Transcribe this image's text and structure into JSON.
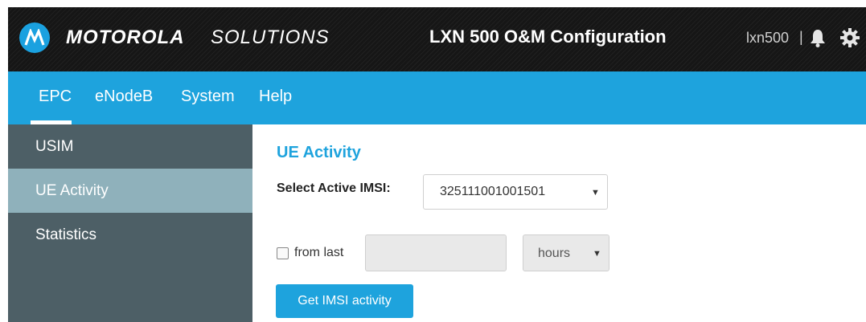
{
  "header": {
    "brand_bold": "MOTOROLA",
    "brand_light": "SOLUTIONS",
    "app_title": "LXN 500 O&M Configuration",
    "user": "lxn500",
    "separator": "|",
    "icons": [
      "motorola-logo-icon",
      "bell-icon",
      "gear-icon"
    ]
  },
  "nav": {
    "items": [
      {
        "label": "EPC",
        "active": true
      },
      {
        "label": "eNodeB",
        "active": false
      },
      {
        "label": "System",
        "active": false
      },
      {
        "label": "Help",
        "active": false
      }
    ]
  },
  "sidebar": {
    "items": [
      {
        "label": "USIM",
        "active": false
      },
      {
        "label": "UE Activity",
        "active": true
      },
      {
        "label": "Statistics",
        "active": false
      }
    ]
  },
  "main": {
    "title": "UE Activity",
    "imsi_label": "Select Active IMSI:",
    "imsi_value": "325111001001501",
    "from_last_label": "from last",
    "from_last_checked": false,
    "duration_value": "",
    "unit_value": "hours",
    "get_button": "Get IMSI activity"
  },
  "colors": {
    "accent": "#1ea3dd",
    "sidebar_bg": "#4d5f66",
    "sidebar_active": "#8fb1bb",
    "header_bg": "#161616"
  }
}
